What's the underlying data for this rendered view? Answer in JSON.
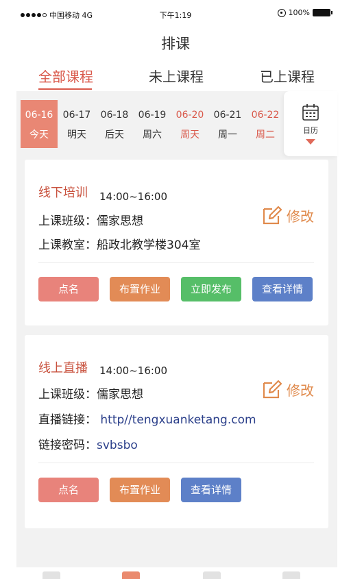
{
  "status_bar": {
    "carrier": "中国移动 4G",
    "time": "下午1:19",
    "battery": "100%"
  },
  "nav": {
    "title": "排课"
  },
  "tabs": [
    {
      "label": "全部课程",
      "active": true
    },
    {
      "label": "未上课程",
      "active": false
    },
    {
      "label": "已上课程",
      "active": false
    }
  ],
  "dates": [
    {
      "date": "06-16",
      "weekday": "今天",
      "state": "today"
    },
    {
      "date": "06-17",
      "weekday": "明天",
      "state": "normal"
    },
    {
      "date": "06-18",
      "weekday": "后天",
      "state": "normal"
    },
    {
      "date": "06-19",
      "weekday": "周六",
      "state": "normal"
    },
    {
      "date": "06-20",
      "weekday": "周天",
      "state": "weekend"
    },
    {
      "date": "06-21",
      "weekday": "周一",
      "state": "normal"
    },
    {
      "date": "06-22",
      "weekday": "周二",
      "state": "weekend"
    }
  ],
  "calendar": {
    "label": "日历",
    "icon": "calendar-icon"
  },
  "cards": [
    {
      "type": "线下培训",
      "time": "14:00~16:00",
      "class_label": "上课班级：",
      "class_value": "儒家思想",
      "room_label": "上课教室：",
      "room_value": "船政北教学楼304室",
      "edit_label": "修改",
      "buttons": [
        "点名",
        "布置作业",
        "立即发布",
        "查看详情"
      ]
    },
    {
      "type": "线上直播",
      "time": "14:00~16:00",
      "class_label": "上课班级：",
      "class_value": "儒家思想",
      "link_label": "直播链接：",
      "link_value": "http//tengxuanketang.com",
      "pwd_label": "链接密码：",
      "pwd_value": "svbsbo",
      "edit_label": "修改",
      "buttons": [
        "点名",
        "布置作业",
        "查看详情"
      ]
    }
  ],
  "colors": {
    "accent": "#d9584a",
    "today_bg": "#e98774",
    "edit": "#e08a4c",
    "btn_red": "#e8837b",
    "btn_orange": "#e28b56",
    "btn_green": "#56be68",
    "btn_blue": "#5d80c8",
    "link": "#2b3f8a"
  }
}
